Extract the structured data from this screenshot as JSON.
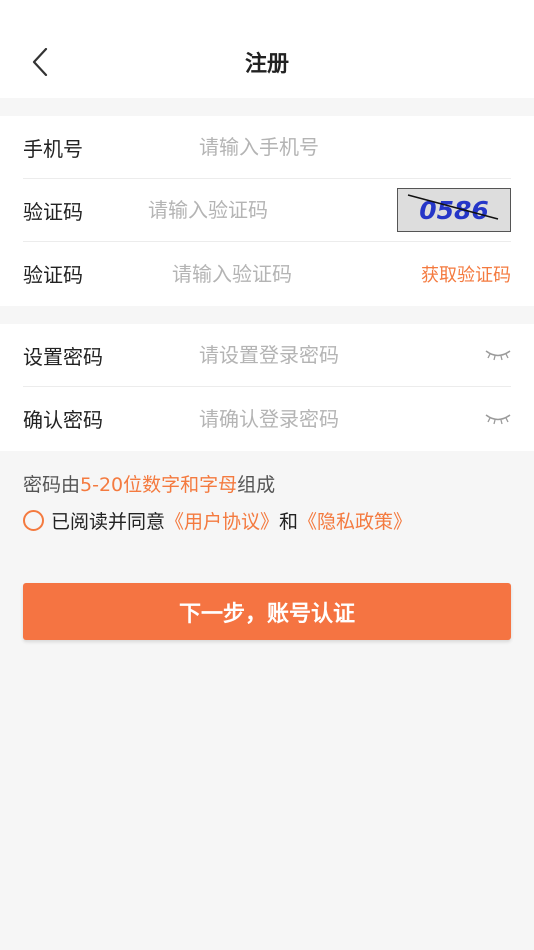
{
  "header": {
    "title": "注册",
    "back_icon": "chevron-left-icon"
  },
  "form": {
    "phone": {
      "label": "手机号",
      "placeholder": "请输入手机号"
    },
    "image_code": {
      "label": "验证码",
      "placeholder": "请输入验证码",
      "captcha_text": "0586"
    },
    "sms_code": {
      "label": "验证码",
      "placeholder": "请输入验证码",
      "get_code_label": "获取验证码"
    },
    "password": {
      "label": "设置密码",
      "placeholder": "请设置登录密码",
      "toggle_icon": "eye-closed-icon"
    },
    "confirm_password": {
      "label": "确认密码",
      "placeholder": "请确认登录密码",
      "toggle_icon": "eye-closed-icon"
    }
  },
  "hint": {
    "prefix": "密码由",
    "highlight": "5-20位数字和字母",
    "suffix": "组成"
  },
  "agreement": {
    "text": "已阅读并同意",
    "user_agreement": "《用户协议》",
    "and": "和",
    "privacy_policy": "《隐私政策》"
  },
  "next_button": {
    "label": "下一步，账号认证"
  },
  "colors": {
    "accent": "#f47a3f",
    "button": "#f57442",
    "background": "#f6f6f6"
  }
}
